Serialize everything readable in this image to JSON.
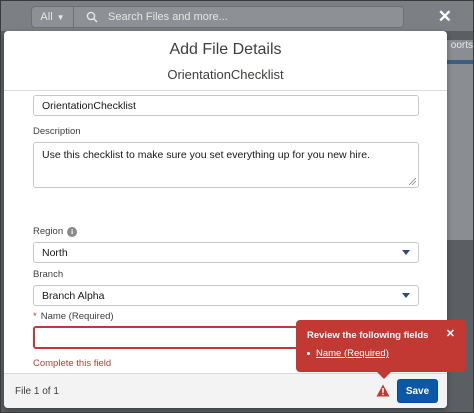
{
  "background": {
    "search_scope": "All",
    "search_placeholder": "Search Files and more...",
    "right_partial_text": "oorts"
  },
  "modal": {
    "title": "Add File Details",
    "subtitle": "OrientationChecklist",
    "fields": {
      "title_value": "OrientationChecklist",
      "description_label": "Description",
      "description_value": "Use this checklist to make sure you set everything up for you new hire.",
      "region_label": "Region",
      "region_value": "North",
      "branch_label": "Branch",
      "branch_value": "Branch Alpha",
      "name_required_star": "*",
      "name_label": "Name (Required)",
      "name_value": "",
      "name_error": "Complete this field"
    },
    "footer": {
      "file_count": "File 1 of 1",
      "save_label": "Save"
    }
  },
  "error_popover": {
    "title": "Review the following fields",
    "items": [
      "Name (Required)"
    ]
  },
  "colors": {
    "error": "#c23934",
    "brand": "#0b57a8"
  }
}
